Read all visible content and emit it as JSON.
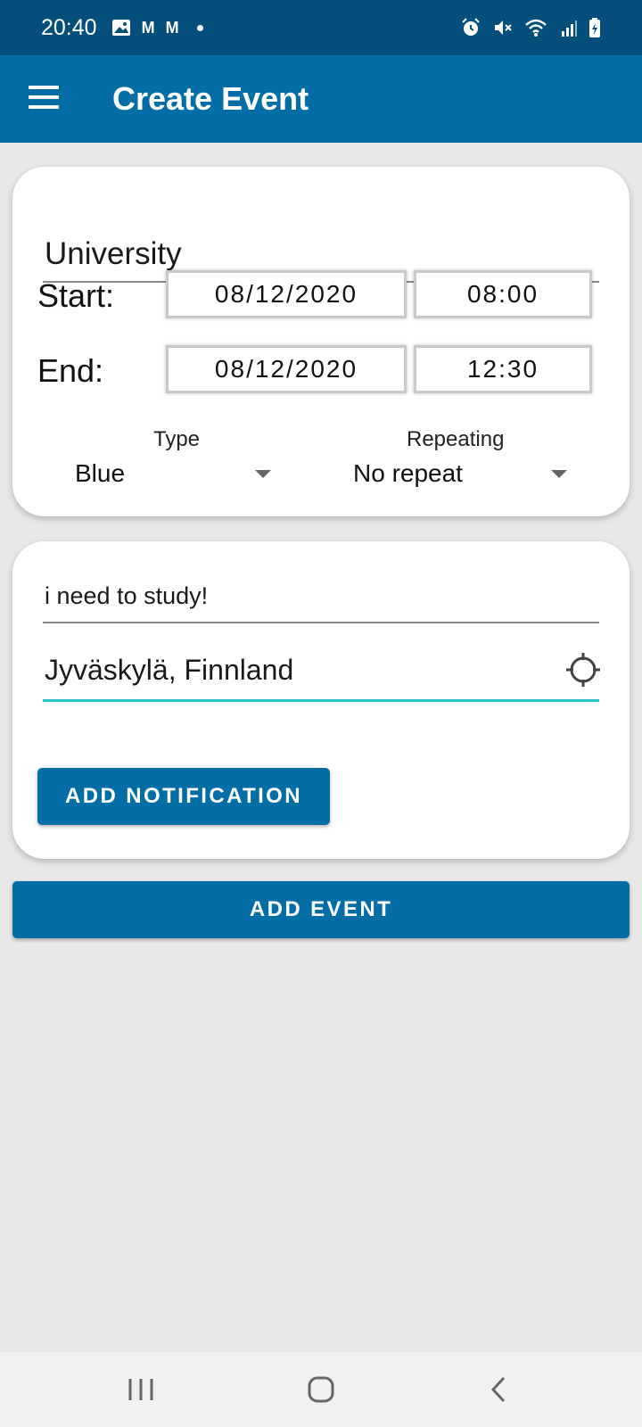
{
  "status_bar": {
    "time": "20:40",
    "left_icons": [
      "image-icon",
      "gmail-icon",
      "gmail-icon",
      "dot-icon"
    ],
    "right_icons": [
      "alarm-icon",
      "mute-icon",
      "wifi-icon",
      "signal-icon",
      "battery-icon"
    ],
    "mail_glyph": "M"
  },
  "app_bar": {
    "title": "Create Event",
    "menu_icon": "menu-icon"
  },
  "event_card": {
    "title_value": "University",
    "start_label": "Start:",
    "end_label": "End:",
    "start_date": "08/12/2020",
    "start_time": "08:00",
    "end_date": "08/12/2020",
    "end_time": "12:30",
    "type_label": "Type",
    "type_value": "Blue",
    "repeating_label": "Repeating",
    "repeating_value": "No repeat"
  },
  "details_card": {
    "description_value": "i need to study!",
    "location_value": "Jyväskylä, Finnland",
    "location_icon": "crosshair-icon",
    "add_notification_label": "ADD NOTIFICATION"
  },
  "add_event_label": "ADD EVENT",
  "colors": {
    "status_bar": "#034e7b",
    "primary": "#036ea6",
    "accent_underline": "#26c6c6",
    "background": "#e8e8e8"
  },
  "nav_bar": {
    "icons": [
      "recents-icon",
      "home-icon",
      "back-icon"
    ]
  }
}
